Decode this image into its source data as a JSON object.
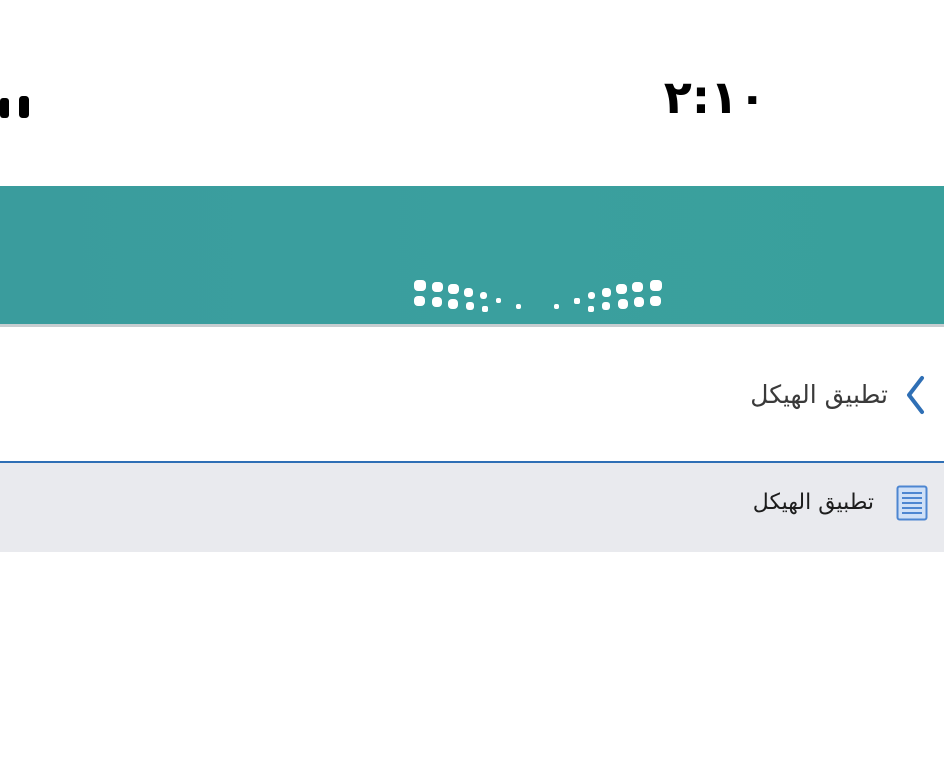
{
  "status_bar": {
    "time": "٢:١٠",
    "signal_icon": "signal-bars-icon"
  },
  "header": {
    "logo_icon": "ministry-logo-dots",
    "background_color": "#3a9f9e"
  },
  "breadcrumb": {
    "label": "تطبيق الهيكل",
    "back_icon": "chevron-right-icon",
    "accent_color": "#2f6fb5"
  },
  "list": {
    "items": [
      {
        "label": "تطبيق الهيكل",
        "icon": "document-icon"
      }
    ]
  }
}
